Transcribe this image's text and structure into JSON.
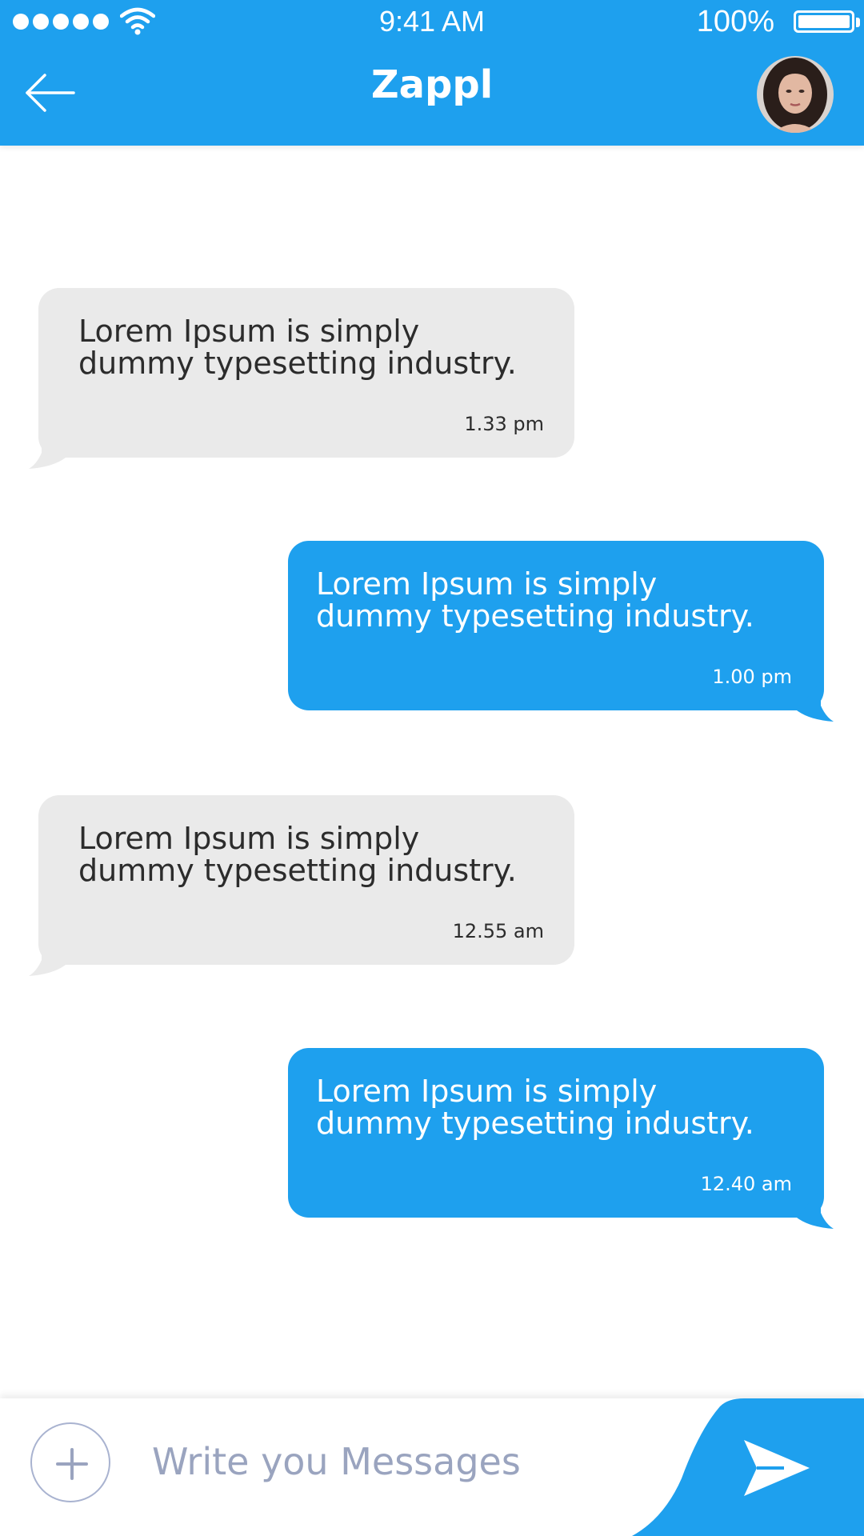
{
  "status_bar": {
    "time": "9:41 AM",
    "battery_percent": "100%",
    "signal_bars": 5
  },
  "header": {
    "title": "Zappl",
    "back_icon": "arrow-left-icon",
    "avatar_icon": "contact-avatar"
  },
  "messages": [
    {
      "direction": "incoming",
      "text": "Lorem Ipsum is simply dummy typesetting industry.",
      "time": "1.33 pm"
    },
    {
      "direction": "outgoing",
      "text": "Lorem Ipsum is simply dummy typesetting industry.",
      "time": "1.00 pm"
    },
    {
      "direction": "incoming",
      "text": "Lorem Ipsum is simply dummy typesetting industry.",
      "time": "12.55 am"
    },
    {
      "direction": "outgoing",
      "text": "Lorem Ipsum is simply dummy typesetting industry.",
      "time": "12.40 am"
    }
  ],
  "composer": {
    "placeholder": "Write you Messages",
    "value": "",
    "add_icon": "plus-icon",
    "send_icon": "send-icon"
  },
  "colors": {
    "accent": "#1ea0ee",
    "incoming_bubble": "#eaeaea",
    "incoming_text": "#2c2c2c",
    "outgoing_text": "#ffffff",
    "placeholder": "#9aa4bf"
  }
}
